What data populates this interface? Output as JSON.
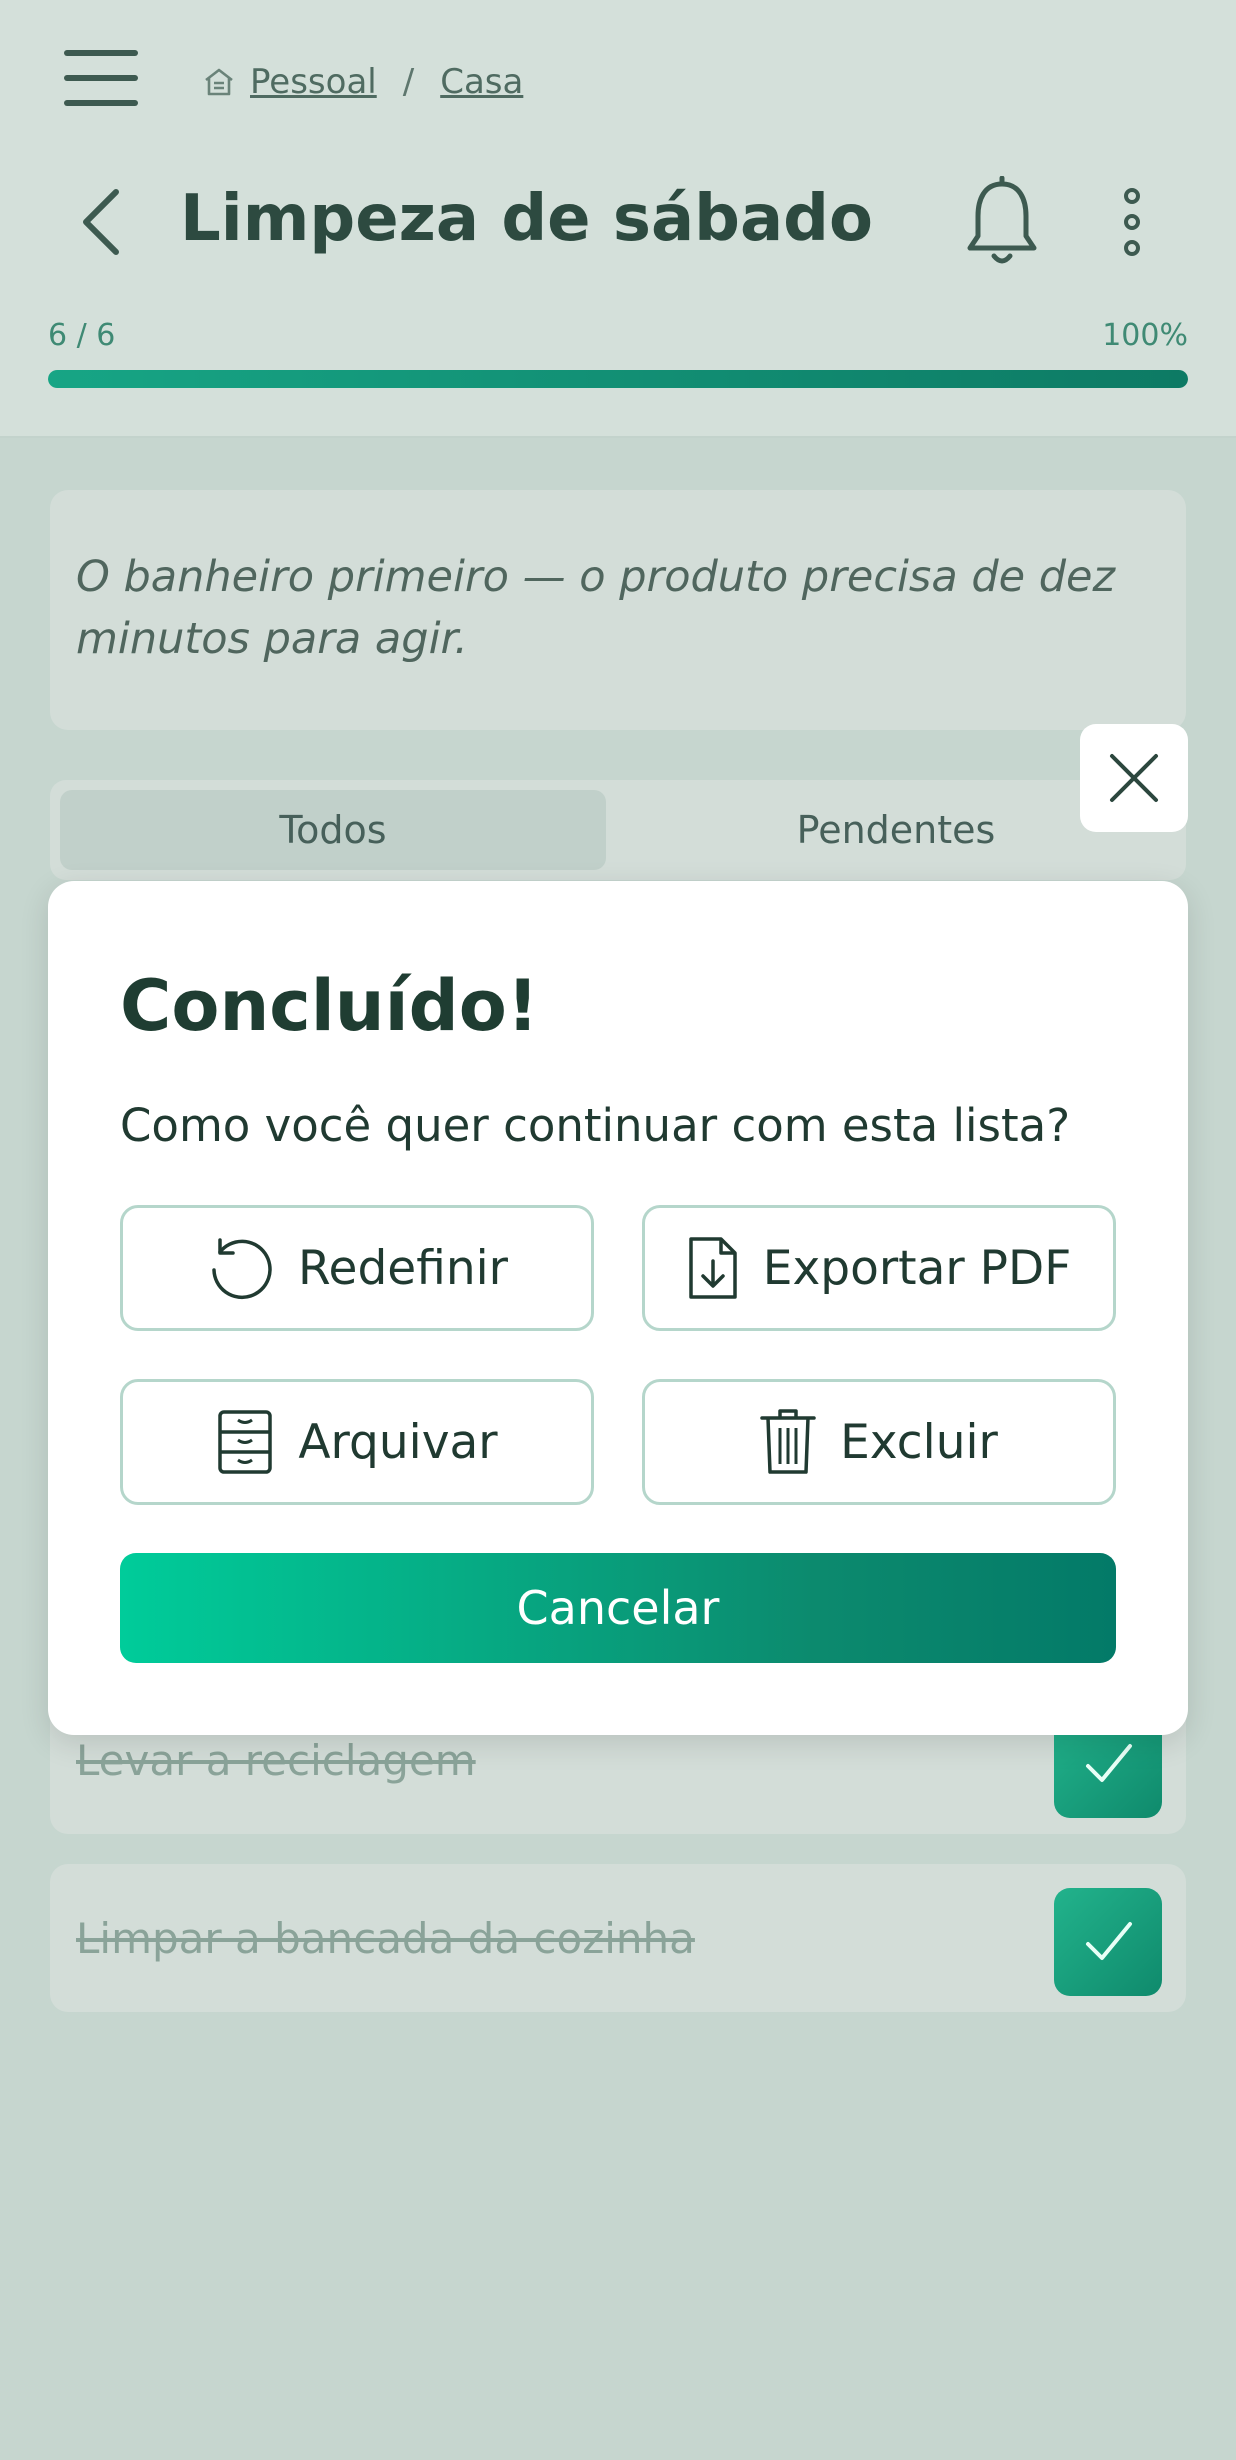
{
  "header": {
    "breadcrumb": [
      "Pessoal",
      "Casa"
    ],
    "breadcrumb_separator": "/",
    "title": "Limpeza de sábado",
    "progress_count": "6 / 6",
    "progress_percent": "100%",
    "progress_fraction": 1.0
  },
  "note": {
    "text": "O banheiro primeiro — o produto precisa de dez minutos para agir."
  },
  "tabs": [
    {
      "label": "Todos",
      "active": true
    },
    {
      "label": "Pendentes",
      "active": false
    }
  ],
  "items": [
    {
      "label": "Levar a reciclagem",
      "done": true
    },
    {
      "label": "Limpar a bancada da cozinha",
      "done": true
    }
  ],
  "modal": {
    "title": "Concluído!",
    "message": "Como você quer continuar com esta lista?",
    "actions": [
      {
        "label": "Redefinir",
        "icon": "reset-icon"
      },
      {
        "label": "Exportar PDF",
        "icon": "file-download-icon"
      },
      {
        "label": "Arquivar",
        "icon": "archive-icon"
      },
      {
        "label": "Excluir",
        "icon": "trash-icon"
      }
    ],
    "cancel_label": "Cancelar"
  },
  "colors": {
    "accent": "#00a884",
    "accent_dark": "#0c7a64",
    "overlay_bg": "#c6d6cf",
    "modal_bg": "#ffffff"
  }
}
